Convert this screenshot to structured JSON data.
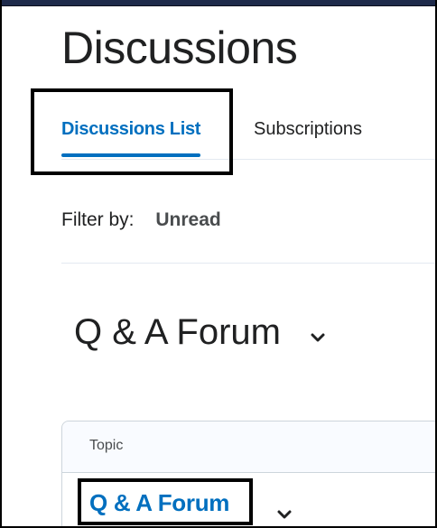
{
  "header": {
    "title": "Discussions"
  },
  "tabs": [
    {
      "label": "Discussions List",
      "active": true
    },
    {
      "label": "Subscriptions",
      "active": false
    }
  ],
  "filter": {
    "label": "Filter by:",
    "value": "Unread"
  },
  "forum": {
    "title": "Q & A Forum",
    "expand_icon": "chevron-down-icon"
  },
  "topic_table": {
    "header": "Topic",
    "rows": [
      {
        "title": "Q & A Forum",
        "menu_icon": "chevron-down-icon"
      }
    ]
  },
  "colors": {
    "accent": "#006fbf",
    "text": "#202122",
    "top_bar": "#1e2a4a"
  }
}
